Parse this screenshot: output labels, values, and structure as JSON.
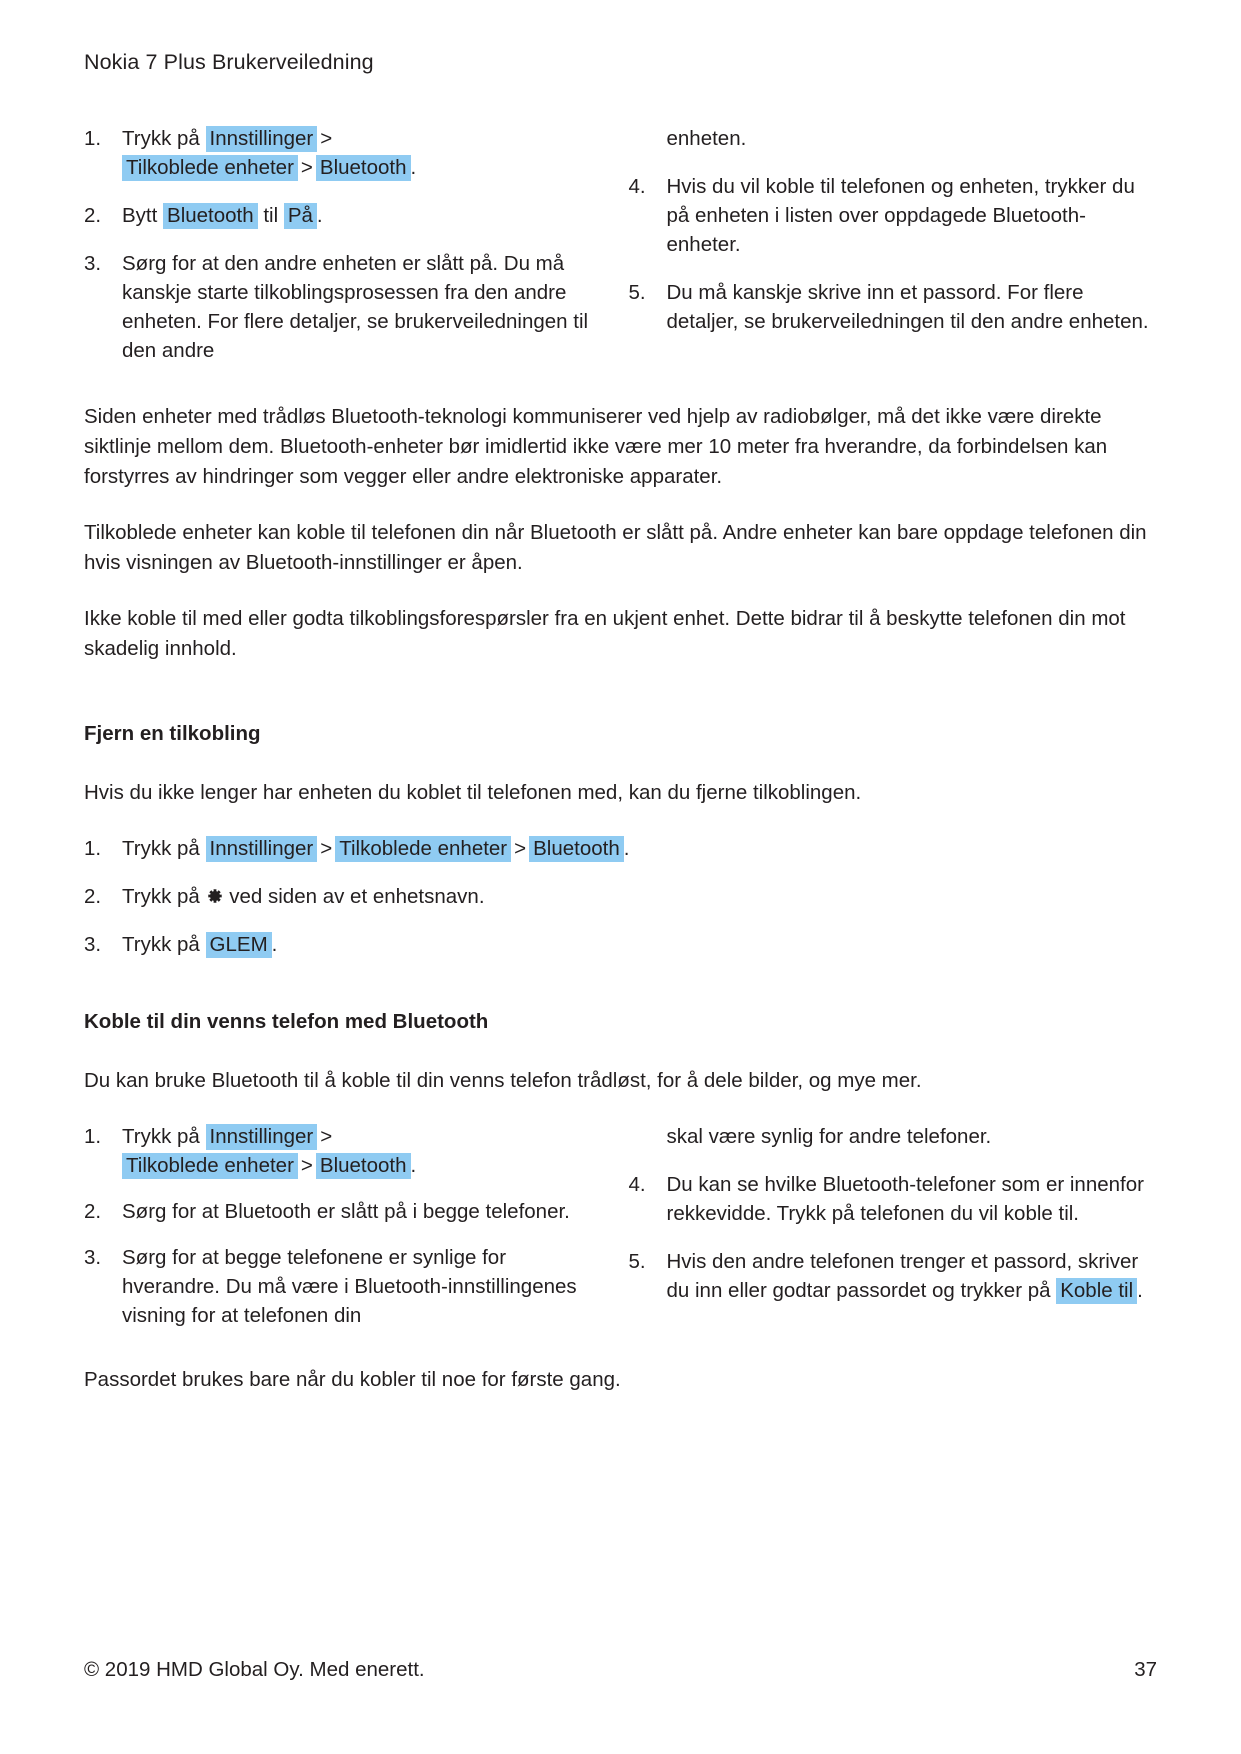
{
  "header": {
    "title": "Nokia 7 Plus Brukerveiledning"
  },
  "section_pair": {
    "steps_left": [
      {
        "num": "1.",
        "parts": [
          {
            "t": "text",
            "v": "Trykk på "
          },
          {
            "t": "hl",
            "v": "Innstillinger"
          },
          {
            "t": "sep",
            "v": ">"
          },
          {
            "t": "br"
          },
          {
            "t": "hl",
            "v": "Tilkoblede enheter"
          },
          {
            "t": "sep",
            "v": ">"
          },
          {
            "t": "hl",
            "v": "Bluetooth"
          },
          {
            "t": "text",
            "v": "."
          }
        ]
      },
      {
        "num": "2.",
        "parts": [
          {
            "t": "text",
            "v": "Bytt "
          },
          {
            "t": "hl",
            "v": "Bluetooth"
          },
          {
            "t": "text",
            "v": " til "
          },
          {
            "t": "hl",
            "v": "På"
          },
          {
            "t": "text",
            "v": "."
          }
        ]
      },
      {
        "num": "3.",
        "parts": [
          {
            "t": "text",
            "v": "Sørg for at den andre enheten er slått på. Du må kanskje starte tilkoblingsprosessen fra den andre enheten. For flere detaljer, se brukerveiledningen til den andre"
          }
        ]
      }
    ],
    "right_continuation": "enheten.",
    "steps_right": [
      {
        "num": "4.",
        "parts": [
          {
            "t": "text",
            "v": "Hvis du vil koble til telefonen og enheten, trykker du på enheten i listen over oppdagede Bluetooth-enheter."
          }
        ]
      },
      {
        "num": "5.",
        "parts": [
          {
            "t": "text",
            "v": "Du må kanskje skrive inn et passord. For flere detaljer, se brukerveiledningen til den andre enheten."
          }
        ]
      }
    ]
  },
  "paragraphs": {
    "radio_waves": "Siden enheter med trådløs Bluetooth-teknologi kommuniserer ved hjelp av radiobølger, må det ikke være direkte siktlinje mellom dem. Bluetooth-enheter bør imidlertid ikke være mer 10 meter fra hverandre, da forbindelsen kan forstyrres av hindringer som vegger eller andre elektroniske apparater.",
    "paired_devices": "Tilkoblede enheter kan koble til telefonen din når Bluetooth er slått på. Andre enheter kan bare oppdage telefonen din hvis visningen av Bluetooth-innstillinger er åpen.",
    "unknown_device": "Ikke koble til med eller godta tilkoblingsforespørsler fra en ukjent enhet. Dette bidrar til å beskytte telefonen din mot skadelig innhold."
  },
  "remove_pairing": {
    "heading": "Fjern en tilkobling",
    "intro": "Hvis du ikke lenger har enheten du koblet til telefonen med, kan du fjerne tilkoblingen.",
    "steps": [
      {
        "num": "1.",
        "parts": [
          {
            "t": "text",
            "v": "Trykk på "
          },
          {
            "t": "hl",
            "v": "Innstillinger"
          },
          {
            "t": "sep",
            "v": ">"
          },
          {
            "t": "hl",
            "v": "Tilkoblede enheter"
          },
          {
            "t": "sep",
            "v": ">"
          },
          {
            "t": "hl",
            "v": "Bluetooth"
          },
          {
            "t": "text",
            "v": "."
          }
        ]
      },
      {
        "num": "2.",
        "parts": [
          {
            "t": "text",
            "v": "Trykk på "
          },
          {
            "t": "gear",
            "v": "gear-icon"
          },
          {
            "t": "text",
            "v": " ved siden av et enhetsnavn."
          }
        ]
      },
      {
        "num": "3.",
        "parts": [
          {
            "t": "text",
            "v": "Trykk på "
          },
          {
            "t": "hl",
            "v": "GLEM"
          },
          {
            "t": "text",
            "v": "."
          }
        ]
      }
    ]
  },
  "friend_phone": {
    "heading": "Koble til din venns telefon med Bluetooth",
    "intro": "Du kan bruke Bluetooth til å koble til din venns telefon trådløst, for å dele bilder, og mye mer.",
    "steps_left": [
      {
        "num": "1.",
        "parts": [
          {
            "t": "text",
            "v": "Trykk på "
          },
          {
            "t": "hl",
            "v": "Innstillinger"
          },
          {
            "t": "sep",
            "v": ">"
          },
          {
            "t": "br"
          },
          {
            "t": "hl",
            "v": "Tilkoblede enheter"
          },
          {
            "t": "sep",
            "v": ">"
          },
          {
            "t": "hl",
            "v": "Bluetooth"
          },
          {
            "t": "text",
            "v": "."
          }
        ]
      },
      {
        "num": "2.",
        "parts": [
          {
            "t": "text",
            "v": "Sørg for at Bluetooth er slått på i begge telefoner."
          }
        ]
      },
      {
        "num": "3.",
        "parts": [
          {
            "t": "text",
            "v": "Sørg for at begge telefonene er synlige for hverandre. Du må være i Bluetooth-innstillingenes visning for at telefonen din"
          }
        ]
      }
    ],
    "right_continuation": "skal være synlig for andre telefoner.",
    "steps_right": [
      {
        "num": "4.",
        "parts": [
          {
            "t": "text",
            "v": "Du kan se hvilke Bluetooth-telefoner som er innenfor rekkevidde. Trykk på telefonen du vil koble til."
          }
        ]
      },
      {
        "num": "5.",
        "parts": [
          {
            "t": "text",
            "v": "Hvis den andre telefonen trenger et passord, skriver du inn eller godtar passordet og trykker på "
          },
          {
            "t": "hl",
            "v": "Koble til"
          },
          {
            "t": "text",
            "v": "."
          }
        ]
      }
    ],
    "outro": "Passordet brukes bare når du kobler til noe for første gang."
  },
  "footer": {
    "copyright": "© 2019 HMD Global Oy. Med enerett.",
    "page_number": "37"
  },
  "colors": {
    "highlight": "#8fcbf2",
    "text": "#231f20",
    "background": "#ffffff"
  }
}
